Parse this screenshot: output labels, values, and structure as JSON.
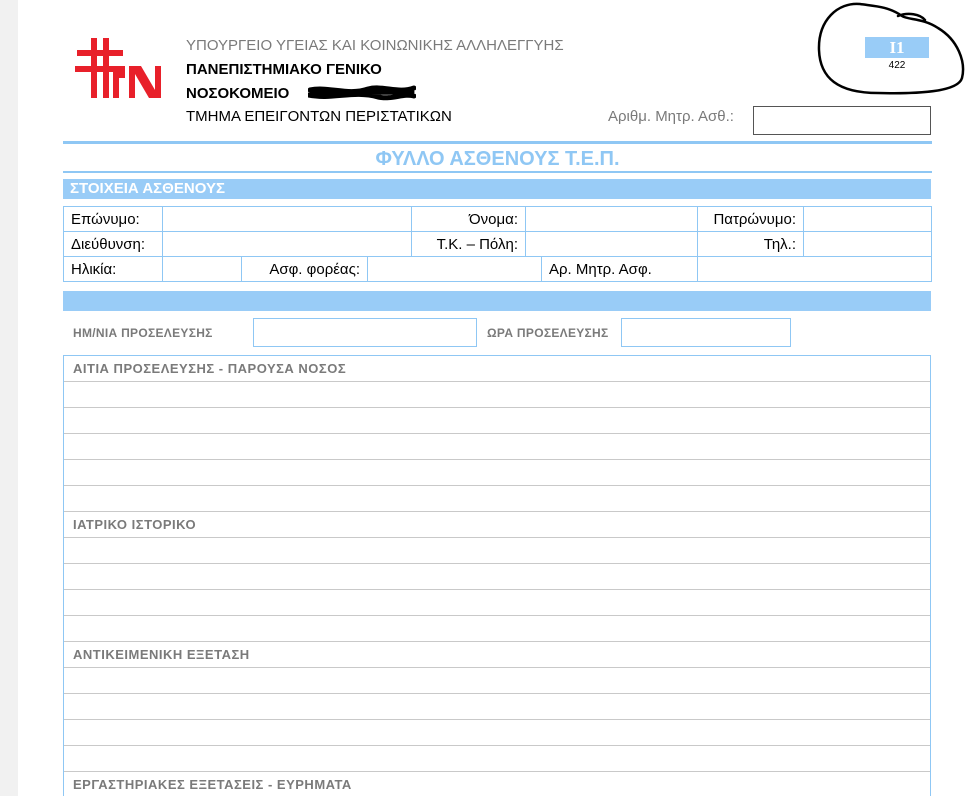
{
  "header": {
    "ministry": "ΥΠΟΥΡΓΕΙΟ ΥΓΕΙΑΣ ΚΑΙ ΚΟΙΝΩΝΙΚΗΣ ΑΛΛΗΛΕΓΓΥΗΣ",
    "hospital_line1": "ΠΑΝΕΠΙΣΤΗΜΙΑΚΟ ΓΕΝΙΚΟ",
    "hospital_line2": "ΝΟΣΟΚΟΜΕΙΟ",
    "department": "ΤΜΗΜΑ ΕΠΕΙΓΟΝΤΩΝ ΠΕΡΙΣΤΑΤΙΚΩΝ",
    "record_label": "Αριθμ. Μητρ. Ασθ.:",
    "record_value": "",
    "form_code": "Ι1",
    "form_number": "422"
  },
  "form": {
    "title": "ΦΥΛΛΟ ΑΣΘΕΝΟΥΣ Τ.Ε.Π."
  },
  "patient": {
    "section_title": "ΣΤΟΙΧΕΙΑ ΑΣΘΕΝΟΥΣ",
    "surname_label": "Επώνυμο:",
    "name_label": "Όνομα:",
    "father_label": "Πατρώνυμο:",
    "address_label": "Διεύθυνση:",
    "zip_city_label": "Τ.Κ. – Πόλη:",
    "phone_label": "Τηλ.:",
    "age_label": "Ηλικία:",
    "insurer_label": "Ασφ. φορέας:",
    "insurance_no_label": "Αρ. Μητρ. Ασφ."
  },
  "visit": {
    "date_label": "ΗΜ/ΝΙΑ ΠΡΟΣΕΛΕΥΣΗΣ",
    "time_label": "ΩΡΑ ΠΡΟΣΕΛΕΥΣΗΣ",
    "date_value": "",
    "time_value": ""
  },
  "sections": {
    "reason": "ΑΙΤΙΑ ΠΡΟΣΕΛΕΥΣΗΣ - ΠΑΡΟΥΣΑ ΝΟΣΟΣ",
    "history": "ΙΑΤΡΙΚΟ ΙΣΤΟΡΙΚΟ",
    "exam": "ΑΝΤΙΚΕΙΜΕΝΙΚΗ ΕΞΕΤΑΣΗ",
    "labs": "ΕΡΓΑΣΤΗΡΙΑΚΕΣ ΕΞΕΤΑΣΕΙΣ - ΕΥΡΗΜΑΤΑ"
  },
  "colors": {
    "accent": "#8fc7f4",
    "logo_red": "#e8202a",
    "label_gray": "#7a7a7a"
  }
}
